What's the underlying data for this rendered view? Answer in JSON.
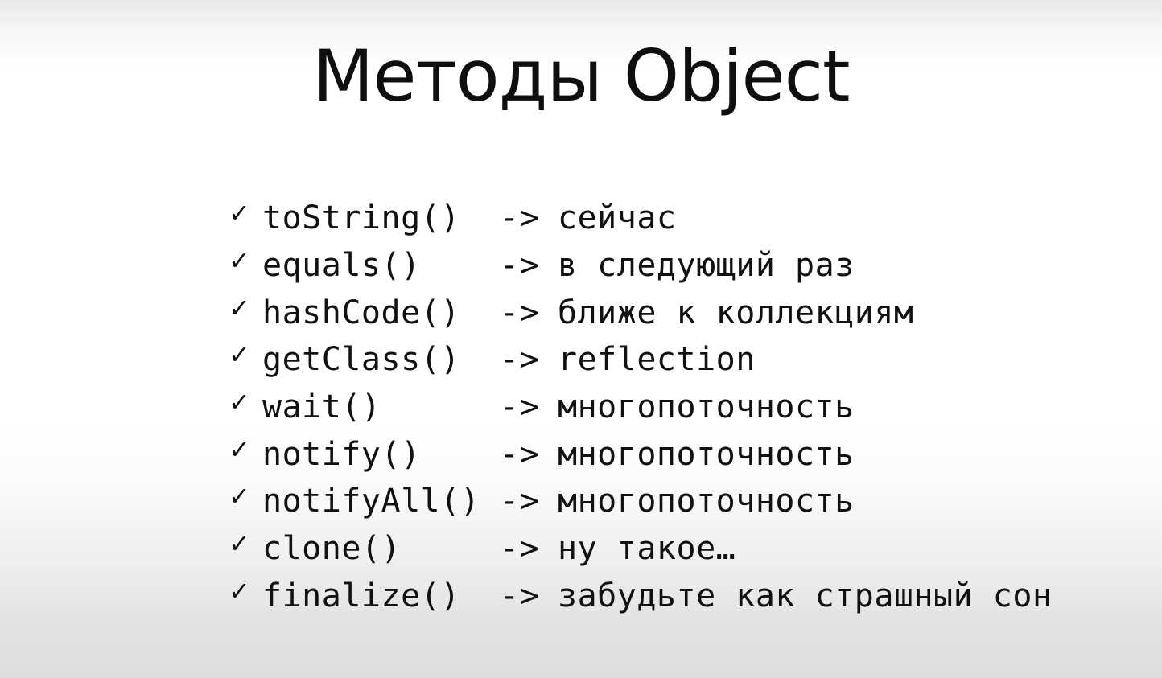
{
  "slide": {
    "title": "Методы Object"
  },
  "methods": [
    {
      "icon": "check-icon",
      "check": "✓",
      "name": "toString()",
      "arrow": "->",
      "description": "сейчас"
    },
    {
      "icon": "check-icon",
      "check": "✓",
      "name": "equals()",
      "arrow": "->",
      "description": "в следующий раз"
    },
    {
      "icon": "check-icon",
      "check": "✓",
      "name": "hashCode()",
      "arrow": "->",
      "description": "ближе к коллекциям"
    },
    {
      "icon": "check-icon",
      "check": "✓",
      "name": "getClass()",
      "arrow": "->",
      "description": "reflection"
    },
    {
      "icon": "check-icon",
      "check": "✓",
      "name": "wait()",
      "arrow": "->",
      "description": "многопоточность"
    },
    {
      "icon": "check-icon",
      "check": "✓",
      "name": "notify()",
      "arrow": "->",
      "description": "многопоточность"
    },
    {
      "icon": "check-icon",
      "check": "✓",
      "name": "notifyAll()",
      "arrow": "->",
      "description": "многопоточность"
    },
    {
      "icon": "check-icon",
      "check": "✓",
      "name": "clone()",
      "arrow": "->",
      "description": "ну такое…"
    },
    {
      "icon": "check-icon",
      "check": "✓",
      "name": "finalize()",
      "arrow": "->",
      "description": "забудьте как страшный сон"
    }
  ]
}
